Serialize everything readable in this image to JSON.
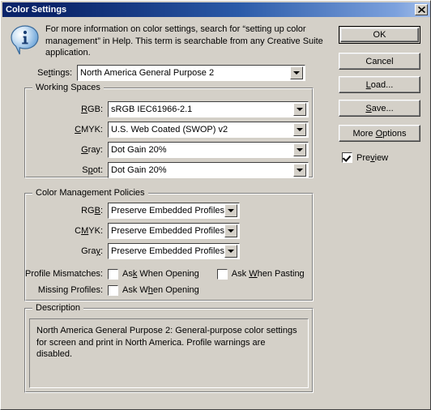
{
  "window": {
    "title": "Color Settings",
    "close_label": "Close",
    "close_icon": "close-icon"
  },
  "header": {
    "icon": "info-balloon-icon",
    "text": "For more information on color settings, search for “setting up color management” in Help. This term is searchable from any Creative Suite application."
  },
  "settings": {
    "label": "Settings:",
    "value": "North America General Purpose 2"
  },
  "working_spaces": {
    "legend": "Working Spaces",
    "rows": [
      {
        "label": "RGB:",
        "value": "sRGB IEC61966-2.1"
      },
      {
        "label": "CMYK:",
        "value": "U.S. Web Coated (SWOP) v2"
      },
      {
        "label": "Gray:",
        "value": "Dot Gain 20%"
      },
      {
        "label": "Spot:",
        "value": "Dot Gain 20%"
      }
    ]
  },
  "policies": {
    "legend": "Color Management Policies",
    "rows": [
      {
        "label": "RGB:",
        "value": "Preserve Embedded Profiles"
      },
      {
        "label": "CMYK:",
        "value": "Preserve Embedded Profiles"
      },
      {
        "label": "Gray:",
        "value": "Preserve Embedded Profiles"
      }
    ],
    "profile_mismatches": {
      "label": "Profile Mismatches:",
      "ask_opening": {
        "label": "Ask When Opening",
        "checked": false
      },
      "ask_pasting": {
        "label": "Ask When Pasting",
        "checked": false
      }
    },
    "missing_profiles": {
      "label": "Missing Profiles:",
      "ask_opening": {
        "label": "Ask When Opening",
        "checked": false
      }
    }
  },
  "description": {
    "legend": "Description",
    "text": "North America General Purpose 2:  General-purpose color settings for screen and print in North America. Profile warnings are disabled."
  },
  "buttons": {
    "ok": "OK",
    "cancel": "Cancel",
    "load": "Load...",
    "save": "Save...",
    "more_options": "More Options"
  },
  "preview": {
    "label": "Preview",
    "checked": true
  },
  "colors": {
    "dialog_face": "#d4d0c8",
    "titlebar_start": "#0a246a",
    "titlebar_end": "#a6c0ea",
    "field_background": "#ffffff",
    "text": "#000000"
  }
}
